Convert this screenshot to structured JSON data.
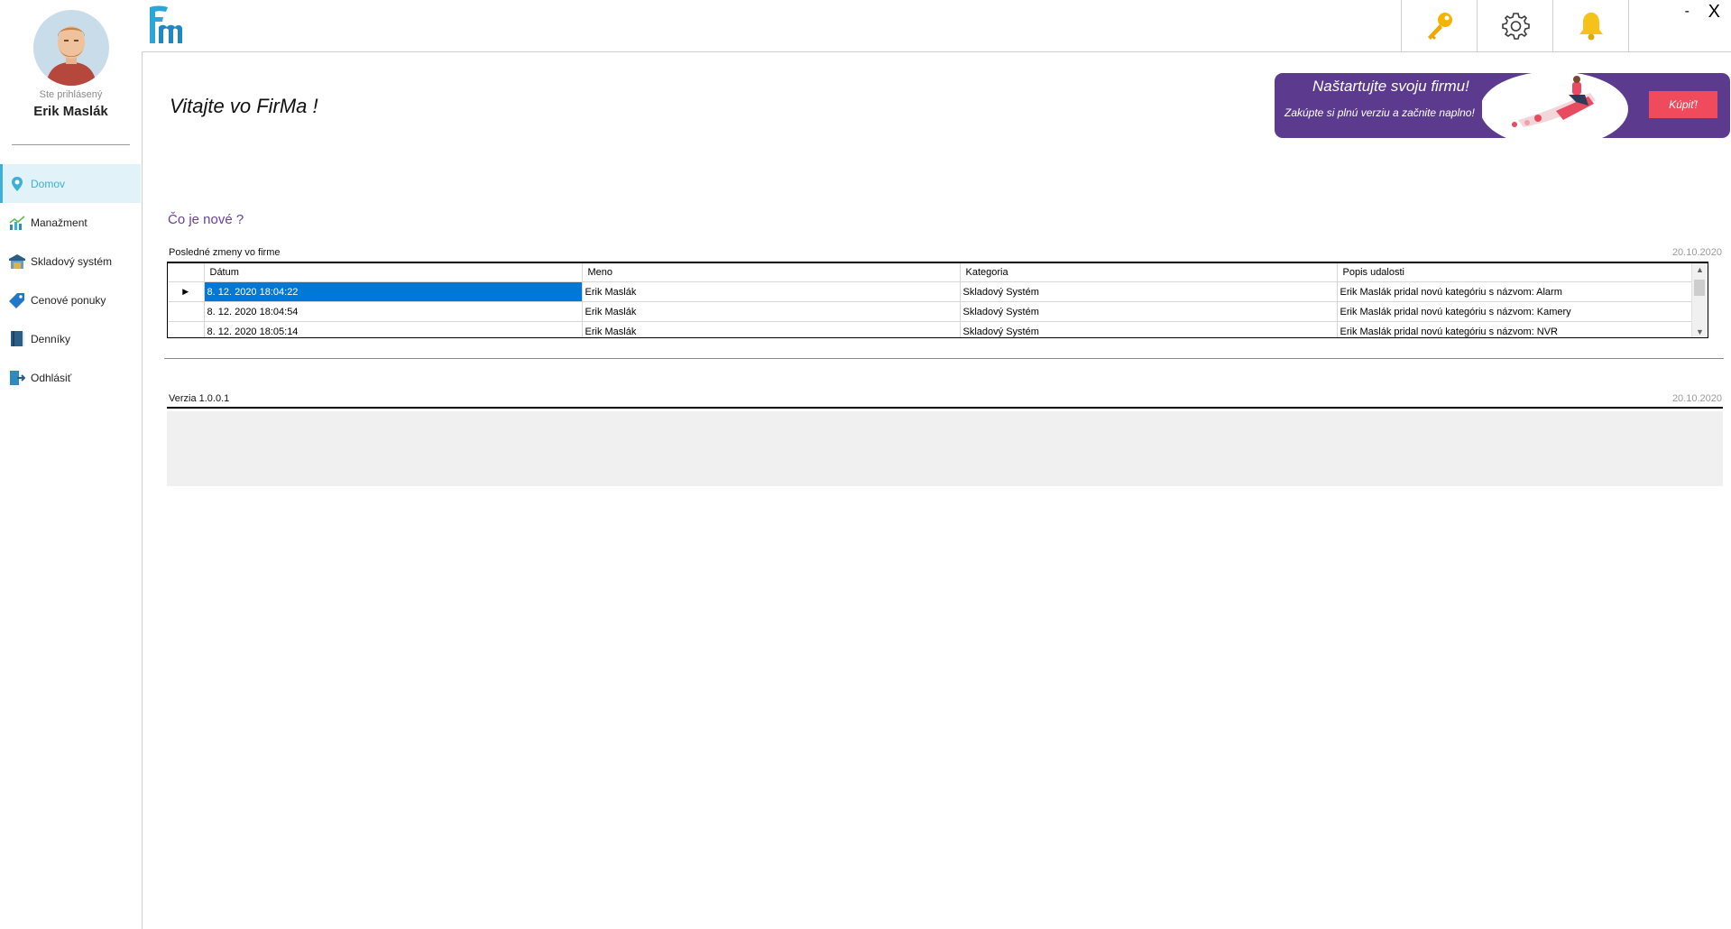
{
  "sidebar": {
    "logged_label": "Ste prihlásený",
    "user_name": "Erik Maslák",
    "items": [
      {
        "label": "Domov",
        "icon": "pin-icon",
        "active": true
      },
      {
        "label": "Manažment",
        "icon": "chart-icon",
        "active": false
      },
      {
        "label": "Skladový systém",
        "icon": "warehouse-icon",
        "active": false
      },
      {
        "label": "Cenové ponuky",
        "icon": "tag-icon",
        "active": false
      },
      {
        "label": "Denníky",
        "icon": "book-icon",
        "active": false
      },
      {
        "label": "Odhlásiť",
        "icon": "logout-icon",
        "active": false
      }
    ]
  },
  "topbar": {
    "logo": "Fm",
    "buttons": [
      "key-icon",
      "gear-icon",
      "bell-icon"
    ],
    "minimize": "-",
    "close": "X"
  },
  "main": {
    "welcome": "Vitajte vo FirMa !",
    "promo": {
      "title": "Naštartujte svoju firmu!",
      "subtitle": "Zakúpte si plnú verziu a začnite naplno!",
      "buy_label": "Kúpiť!"
    },
    "whats_new": "Čo je nové ?",
    "changes": {
      "label": "Posledné zmeny vo firme",
      "date": "20.10.2020",
      "columns": [
        "Dátum",
        "Meno",
        "Kategoria",
        "Popis udalosti"
      ],
      "rows": [
        {
          "datum": "8. 12. 2020 18:04:22",
          "meno": "Erik Maslák",
          "kategoria": "Skladový Systém",
          "popis": "Erik Maslák pridal novú kategóriu s názvom: Alarm"
        },
        {
          "datum": "8. 12. 2020 18:04:54",
          "meno": "Erik Maslák",
          "kategoria": "Skladový Systém",
          "popis": "Erik Maslák pridal novú kategóriu s názvom: Kamery"
        },
        {
          "datum": "8. 12. 2020 18:05:14",
          "meno": "Erik Maslák",
          "kategoria": "Skladový Systém",
          "popis": "Erik Maslák pridal novú kategóriu s názvom: NVR"
        }
      ]
    },
    "version": {
      "label": "Verzia 1.0.0.1",
      "date": "20.10.2020"
    }
  },
  "colors": {
    "accent": "#3cb0d6",
    "promo_bg": "#5c3b8e",
    "buy_button": "#f04b5c",
    "heading_purple": "#6a3ea1",
    "selection": "#0078d7"
  }
}
